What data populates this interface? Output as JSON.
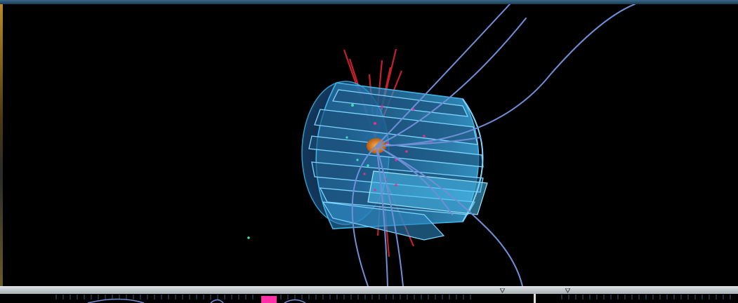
{
  "colors": {
    "background": "#000000",
    "detector": "#3fb4e6",
    "detector_fill": "#1f5e86",
    "track": "#6f8fd6",
    "jet": "#c2202a",
    "hits": "#e0338c",
    "vertex": "#e58a2a",
    "hit_cyan": "#3fe0b0",
    "timeline_marker": "#ff2fa8"
  },
  "icons": {
    "timeline_marker_left": "triangle-down-icon",
    "timeline_marker_right": "triangle-down-icon"
  }
}
